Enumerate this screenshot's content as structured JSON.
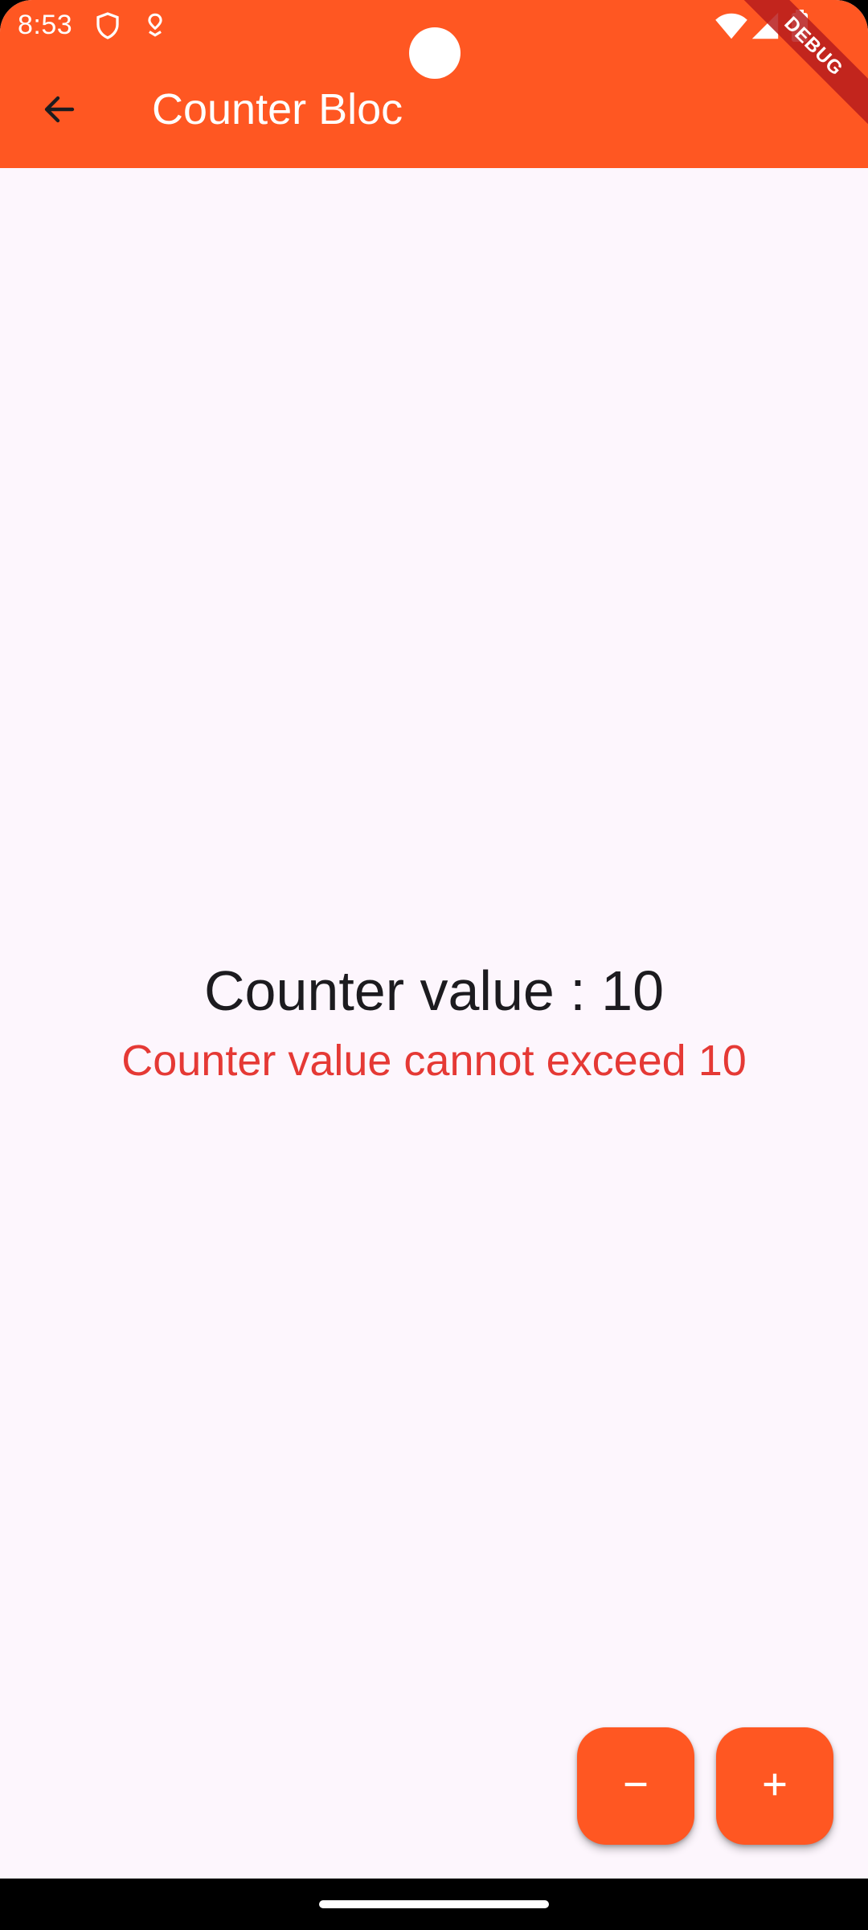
{
  "status_bar": {
    "time": "8:53",
    "icons": [
      "shield-icon",
      "location-pin-icon",
      "wifi-icon",
      "signal-icon",
      "battery-icon"
    ]
  },
  "app_bar": {
    "title": "Counter Bloc",
    "back_icon": "arrow-back-icon",
    "background_color": "#FF5722"
  },
  "debug_banner": {
    "label": "DEBUG"
  },
  "counter": {
    "value_text": "Counter value : 10",
    "error_text": "Counter value cannot exceed 10",
    "error_color": "#E53935"
  },
  "actions": {
    "decrement_icon": "minus-icon",
    "increment_icon": "plus-icon",
    "accent_color": "#FF5722"
  },
  "colors": {
    "background": "#FDF6FD",
    "text_primary": "#1C1B1F"
  }
}
